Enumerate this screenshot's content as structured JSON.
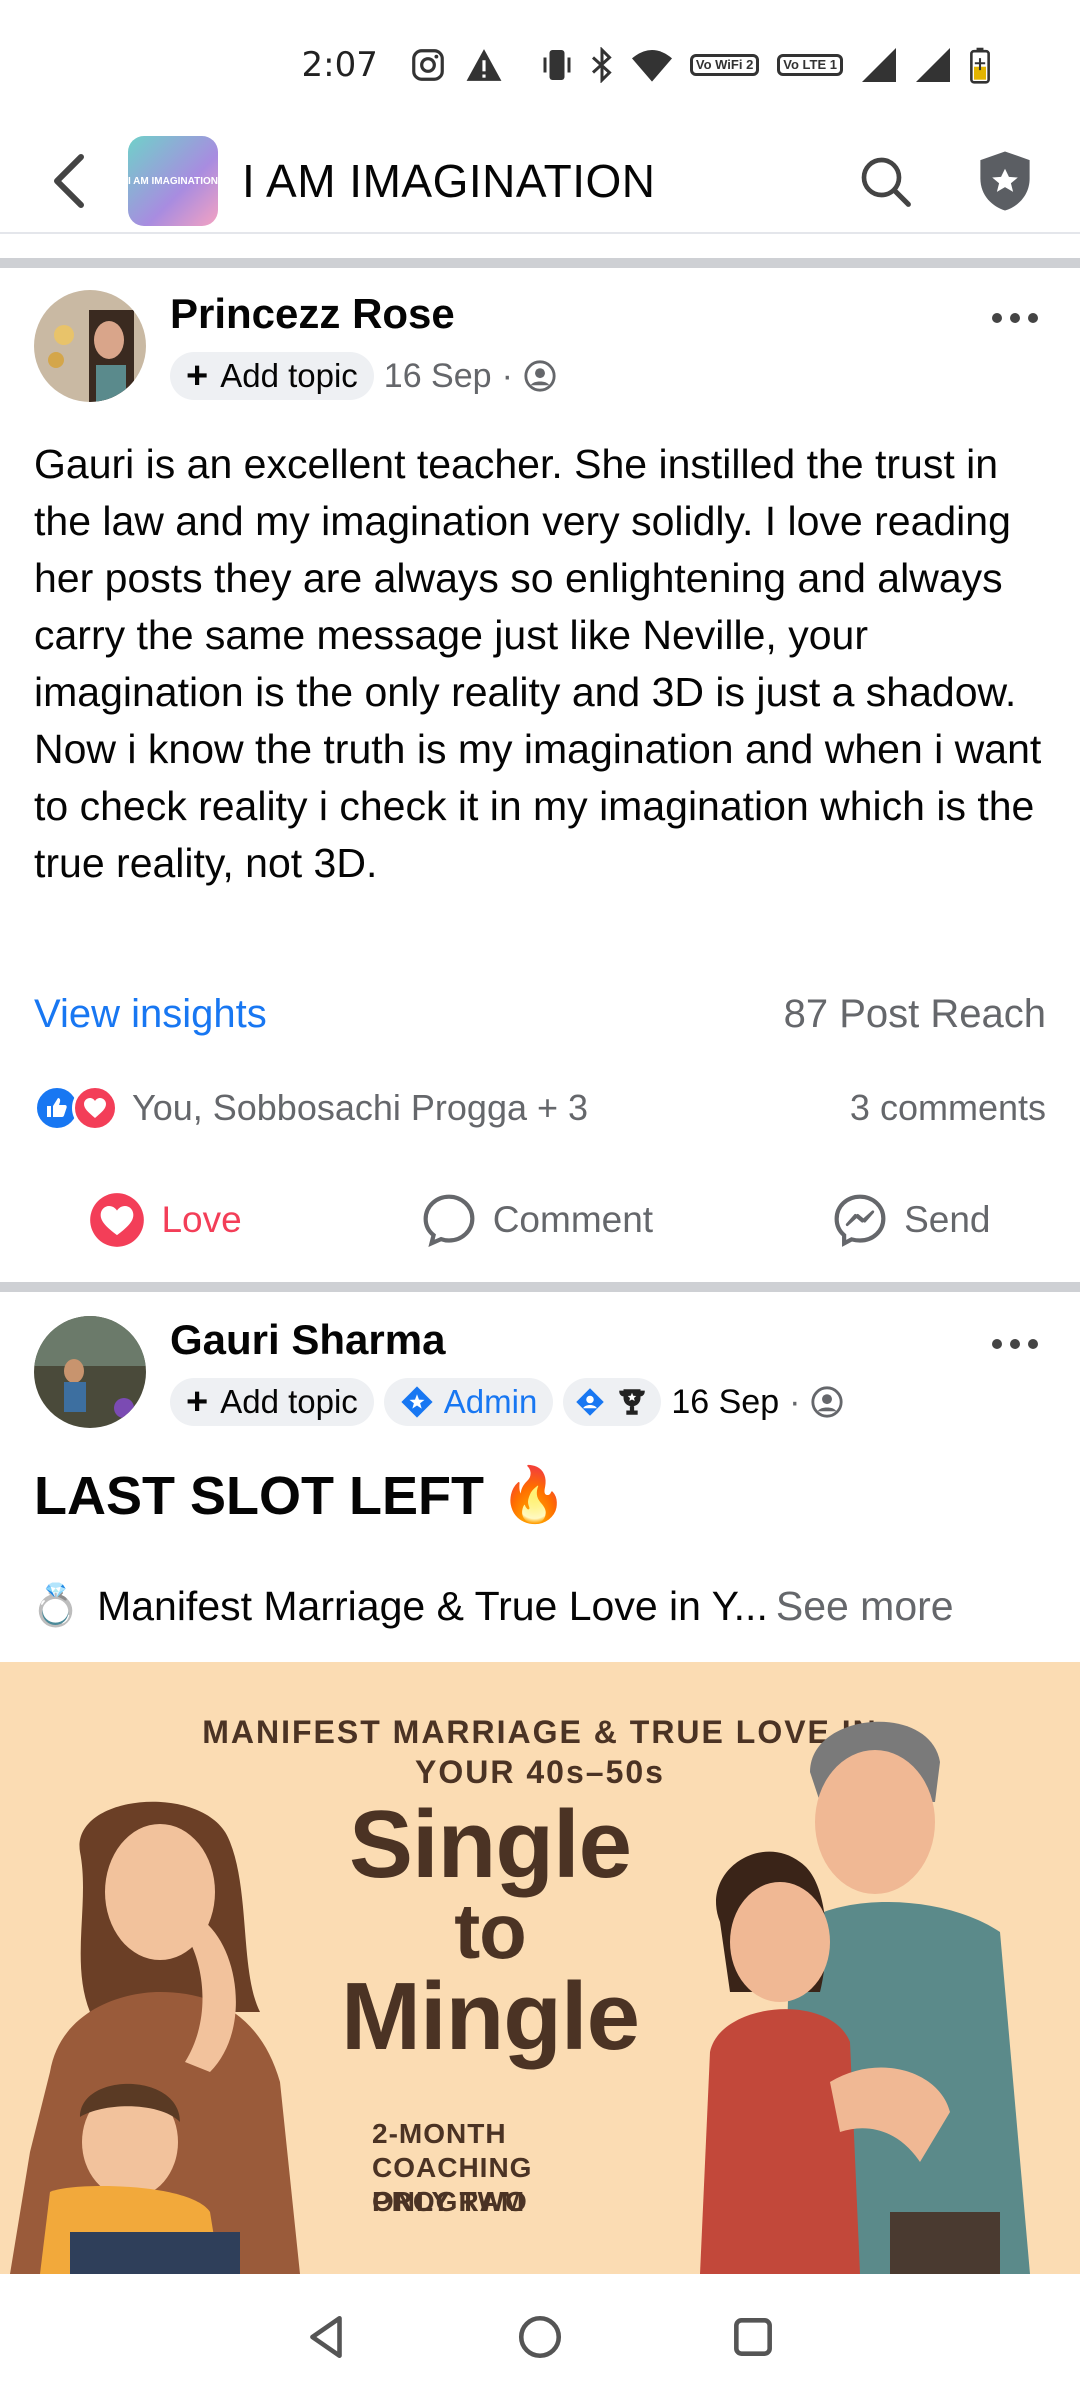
{
  "status_bar": {
    "time": "2:07",
    "icons": [
      "instagram-icon",
      "warning-icon",
      "vibrate-icon",
      "bluetooth-icon",
      "wifi-icon",
      "vowifi2-icon",
      "volte1-icon",
      "signal-icon",
      "signal-icon",
      "battery-charging-icon"
    ],
    "vowifi_label": "Vo WiFi 2",
    "volte_label": "Vo LTE 1"
  },
  "header": {
    "group_title": "I AM IMAGINATION",
    "avatar_text": "I AM IMAGINATION"
  },
  "posts": [
    {
      "author": "Princezz Rose",
      "add_topic": "Add topic",
      "date": "16 Sep",
      "dot": "·",
      "body": "Gauri is an excellent teacher. She instilled the trust in the law and my imagination very solidly. I love reading her posts they are always so enlightening and always carry the same message just like Neville, your imagination is the only reality and 3D is just a shadow. Now i know the truth is my imagination and when i want to check reality i check it in my imagination which is the true reality, not 3D.",
      "view_insights": "View insights",
      "post_reach": "87 Post Reach",
      "reactors": "You, Sobbosachi Progga + 3",
      "comments": "3 comments",
      "actions": {
        "love": "Love",
        "comment": "Comment",
        "send": "Send"
      }
    },
    {
      "author": "Gauri Sharma",
      "add_topic": "Add topic",
      "admin_badge": "Admin",
      "date": "16 Sep",
      "dot": "·",
      "headline": "LAST SLOT LEFT",
      "headline_emoji": "🔥",
      "preview_emoji": "💍",
      "preview_text": "Manifest Marriage & True Love in Y...",
      "see_more": "See more",
      "promo": {
        "top_line1": "MANIFEST MARRIAGE & TRUE LOVE IN",
        "top_line2": "YOUR 40s–50s",
        "title_line1": "Single",
        "title_line2": "to",
        "title_line3": "Mingle",
        "sub_line1": "2-MONTH",
        "sub_line2": "COACHING",
        "sub_line3": "PROGRAM",
        "only": "ONLY TWO"
      }
    }
  ],
  "colors": {
    "accent_blue": "#1877f2",
    "love_red": "#f33e58",
    "promo_bg": "#fbdcb3",
    "promo_text": "#4b3324"
  }
}
